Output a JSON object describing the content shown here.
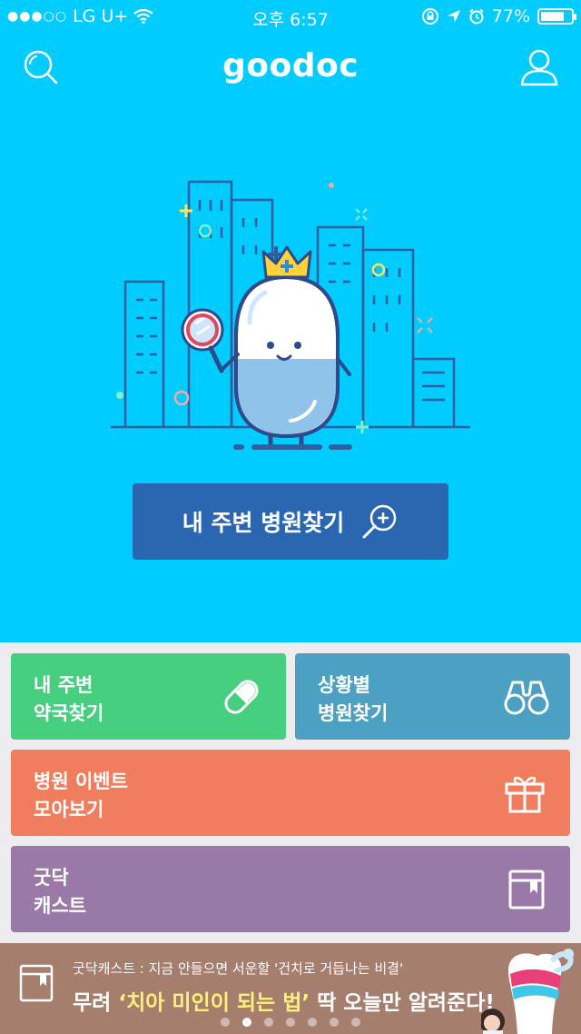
{
  "status_bar": {
    "carrier": "LG U+",
    "time": "오후 6:57",
    "battery": "77%",
    "battery_level": 0.77
  },
  "header": {
    "logo": "goodoc",
    "search_icon": "search-icon",
    "profile_icon": "user-icon"
  },
  "hero": {
    "find_hospital_label": "내 주변 병원찾기",
    "find_icon": "magnifier-plus-icon"
  },
  "tiles": {
    "pharmacy": {
      "line1": "내 주변",
      "line2": "약국찾기",
      "icon": "pill-icon",
      "color": "#45cf7f"
    },
    "situation": {
      "line1": "상황별",
      "line2": "병원찾기",
      "icon": "binoculars-icon",
      "color": "#4ca0c2"
    },
    "event": {
      "line1": "병원 이벤트",
      "line2": "모아보기",
      "icon": "gift-icon",
      "color": "#f07e5e"
    },
    "cast": {
      "line1": "굿닥",
      "line2": "캐스트",
      "icon": "bookmark-book-icon",
      "color": "#9a79a8"
    }
  },
  "banner": {
    "subtitle": "굿닥캐스트 : 지금 안들으면 서운할 '건치로 거듭나는 비결'",
    "title_pre": "무려 ",
    "title_highlight": "‘치아 미인이 되는 법’",
    "title_post": " 딱 오늘만 알려준다!",
    "page_count": 7,
    "active_page": 2
  },
  "colors": {
    "hero_bg": "#00ccff",
    "button_bg": "#2b66b0",
    "banner_bg": "#a67e6e"
  }
}
